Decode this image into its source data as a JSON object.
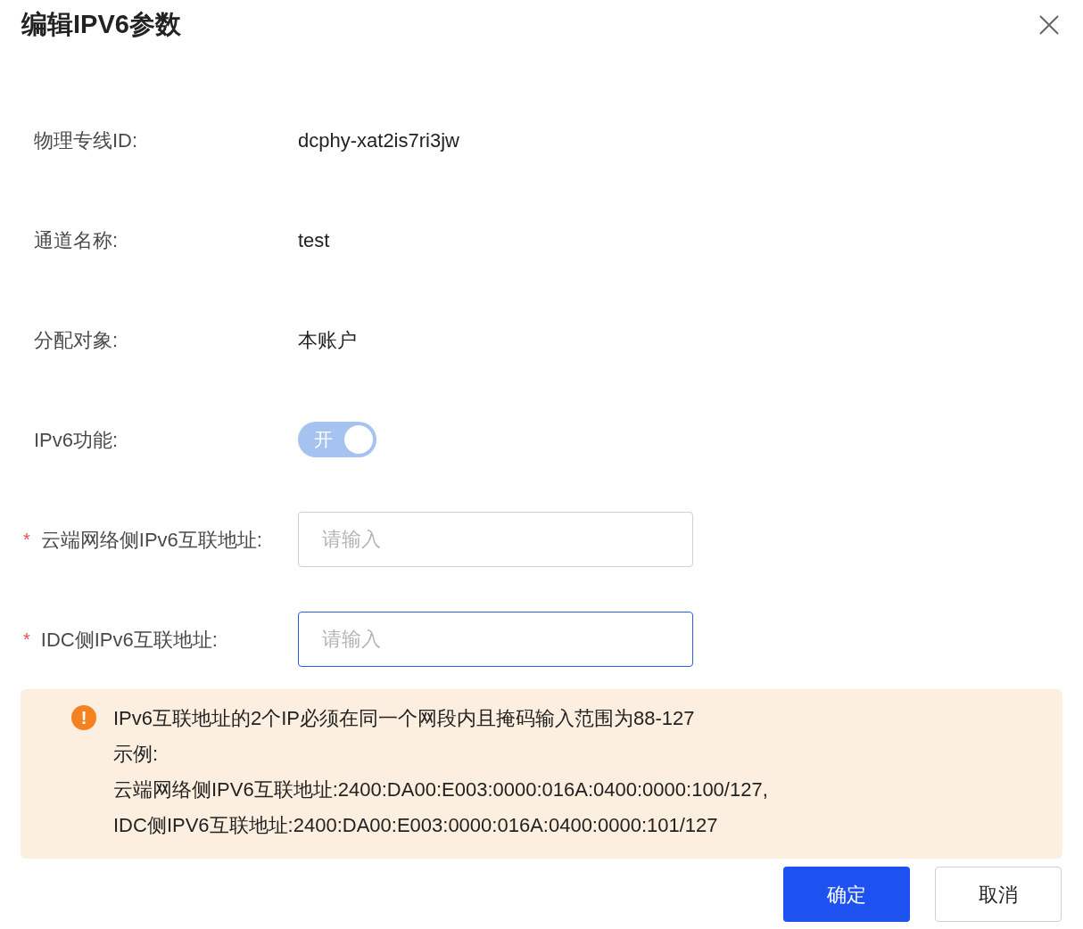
{
  "dialog": {
    "title": "编辑IPV6参数"
  },
  "fields": [
    {
      "kind": "text",
      "label": "物理专线ID:",
      "value": "dcphy-xat2is7ri3jw"
    },
    {
      "kind": "text",
      "label": "通道名称:",
      "value": "test"
    },
    {
      "kind": "text",
      "label": "分配对象:",
      "value": "本账户"
    },
    {
      "kind": "switch",
      "label": "IPv6功能:",
      "on": true,
      "disabled": true,
      "switch_text": "开"
    },
    {
      "kind": "input",
      "label": "云端网络侧IPv6互联地址:",
      "required": true,
      "required_mark": "*",
      "placeholder": "请输入",
      "focused": false
    },
    {
      "kind": "input",
      "label": "IDC侧IPv6互联地址:",
      "required": true,
      "required_mark": "*",
      "placeholder": "请输入",
      "focused": true
    }
  ],
  "alert": {
    "icon_text": "!",
    "lines": [
      "IPv6互联地址的2个IP必须在同一个网段内且掩码输入范围为88-127",
      "示例:",
      "云端网络侧IPV6互联地址:2400:DA00:E003:0000:016A:0400:0000:100/127,",
      "IDC侧IPV6互联地址:2400:DA00:E003:0000:016A:0400:0000:101/127"
    ]
  },
  "buttons": [
    {
      "label": "确定",
      "primary": true
    },
    {
      "label": "取消",
      "primary": false
    }
  ]
}
